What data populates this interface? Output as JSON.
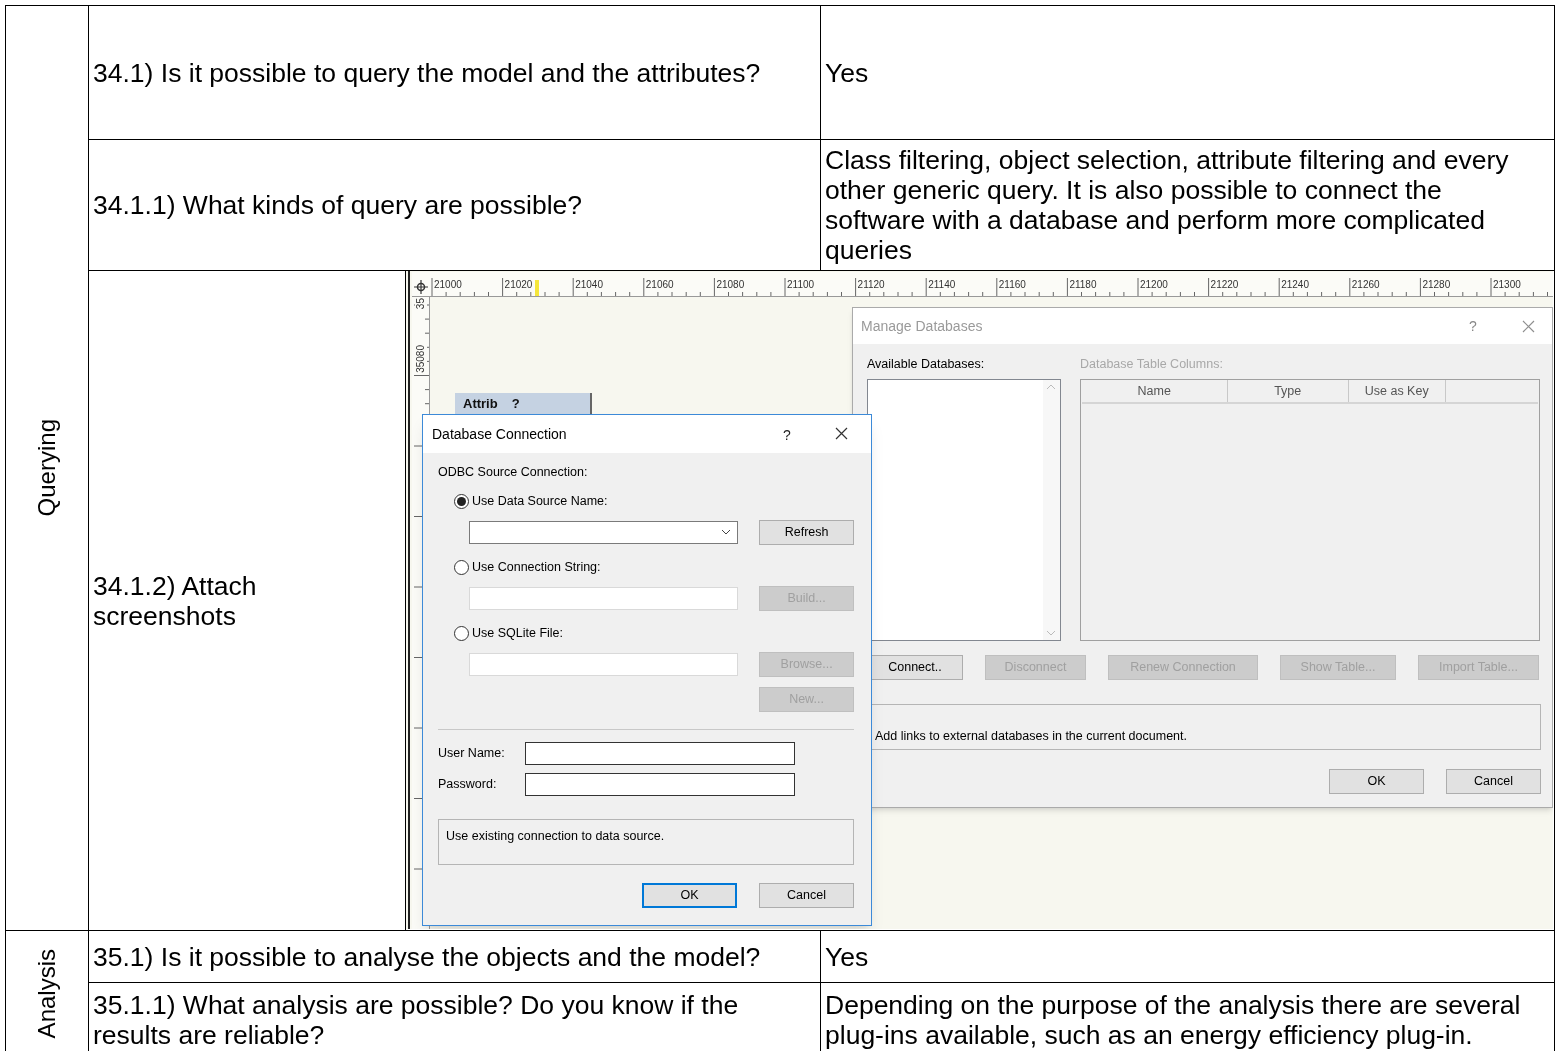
{
  "table": {
    "sections": [
      {
        "category": "Querying",
        "rows": [
          {
            "kind": "text",
            "question": "34.1) Is it possible to query the model and the attributes?",
            "answer": "Yes"
          },
          {
            "kind": "text",
            "question": "34.1.1) What kinds of query are possible?",
            "answer": "Class filtering, object selection, attribute filtering and every other generic query. It is also possible to connect the software with a database and perform more complicated queries"
          },
          {
            "kind": "screenshot",
            "question": "34.1.2) Attach screenshots"
          }
        ]
      },
      {
        "category": "Analysis",
        "rows": [
          {
            "kind": "text",
            "question": "35.1) Is it possible to analyse the objects and the model?",
            "answer": "Yes"
          },
          {
            "kind": "text",
            "question": "35.1.1) What analysis are possible? Do you know if the results are reliable?",
            "answer": "Depending on the purpose of the analysis there are several plug-ins available, such as an energy efficiency plug-in."
          }
        ]
      }
    ]
  },
  "screenshot": {
    "ruler": {
      "x_labels": [
        "21000",
        "21020",
        "21040",
        "21060",
        "21080",
        "21100",
        "21120",
        "21140",
        "21160",
        "21180",
        "21200",
        "21220",
        "21240",
        "21260",
        "21280",
        "21300"
      ],
      "y_labels": [
        "35",
        "35080"
      ]
    },
    "attrib_panel": {
      "title": "Attrib",
      "help": "?"
    },
    "database_connection": {
      "title": "Database Connection",
      "help": "?",
      "group_label": "ODBC Source Connection:",
      "options": [
        {
          "label": "Use Data Source Name:",
          "selected": true,
          "kind": "combo",
          "button": {
            "label": "Refresh",
            "disabled": false
          }
        },
        {
          "label": "Use Connection String:",
          "selected": false,
          "kind": "text",
          "button": {
            "label": "Build...",
            "disabled": true
          }
        },
        {
          "label": "Use SQLite File:",
          "selected": false,
          "kind": "text",
          "button": {
            "label": "Browse...",
            "disabled": true
          }
        }
      ],
      "extra_button": {
        "label": "New...",
        "disabled": true
      },
      "fields": [
        {
          "label": "User Name:"
        },
        {
          "label": "Password:"
        }
      ],
      "description": "Use existing connection to data source.",
      "buttons": [
        {
          "label": "OK",
          "default": true
        },
        {
          "label": "Cancel",
          "default": false
        }
      ]
    },
    "manage_databases": {
      "title": "Manage Databases",
      "active": false,
      "help": "?",
      "available_label": "Available Databases:",
      "columns_label": "Database Table Columns:",
      "columns": [
        "Name",
        "Type",
        "Use as Key"
      ],
      "buttons": [
        {
          "label": "Connect..",
          "disabled": false
        },
        {
          "label": "Disconnect",
          "disabled": true
        },
        {
          "label": "Renew Connection",
          "disabled": true
        },
        {
          "label": "Show Table...",
          "disabled": true
        },
        {
          "label": "Import Table...",
          "disabled": true
        }
      ],
      "description": "Add links to external databases in the current document.",
      "dialog_buttons": [
        {
          "label": "OK",
          "default": false
        },
        {
          "label": "Cancel",
          "default": false
        }
      ]
    }
  }
}
